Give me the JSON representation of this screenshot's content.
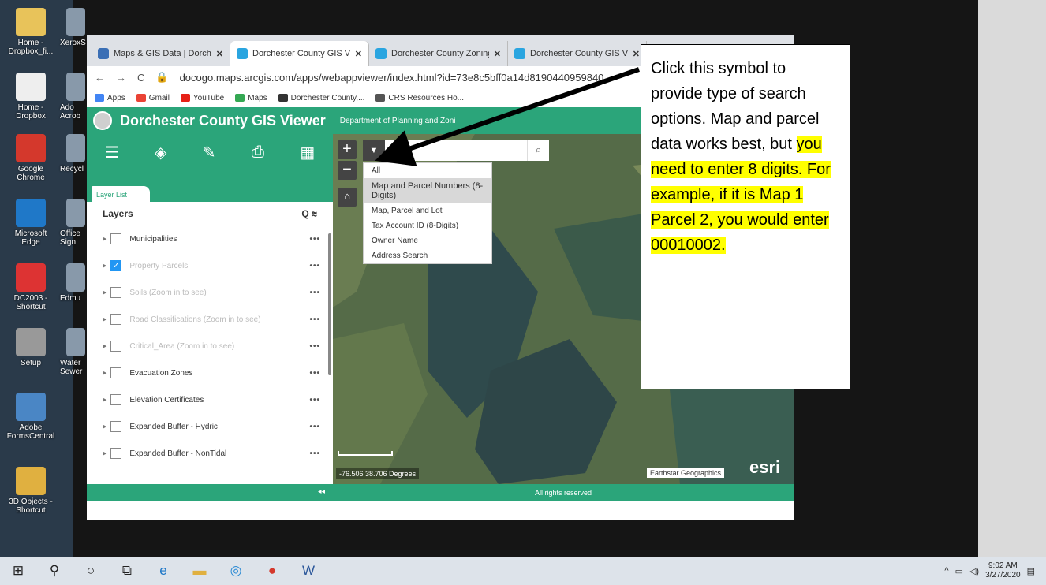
{
  "desktop": {
    "icons": [
      {
        "label": "Home - Dropbox_fi...",
        "color": "#e8c35a"
      },
      {
        "label": "Home - Dropbox",
        "color": "#eeeeee"
      },
      {
        "label": "Google Chrome",
        "color": "#d4382c"
      },
      {
        "label": "Microsoft Edge",
        "color": "#1f78c8"
      },
      {
        "label": "DC2003 - Shortcut",
        "color": "#d33"
      },
      {
        "label": "Setup",
        "color": "#999"
      },
      {
        "label": "Adobe FormsCentral",
        "color": "#4a86c5"
      },
      {
        "label": "3D Objects - Shortcut",
        "color": "#e0b040"
      }
    ],
    "icons2": [
      {
        "label": "XeroxS"
      },
      {
        "label": "Ado Acrob"
      },
      {
        "label": "Recycl"
      },
      {
        "label": "Office Sign"
      },
      {
        "label": "Edmu"
      },
      {
        "label": "Water Sewer"
      }
    ]
  },
  "browser": {
    "tabs": [
      {
        "label": "Maps & GIS Data | Dorche",
        "active": false,
        "color": "#3b6fb5"
      },
      {
        "label": "Dorchester County GIS Vie",
        "active": true,
        "color": "#2aa5e0"
      },
      {
        "label": "Dorchester County Zoning",
        "active": false,
        "color": "#2aa5e0"
      },
      {
        "label": "Dorchester County GIS Vie",
        "active": false,
        "color": "#2aa5e0"
      }
    ],
    "url": "docogo.maps.arcgis.com/apps/webappviewer/index.html?id=73e8c5bff0a14d8190440959840",
    "bookmarks": [
      {
        "label": "Apps",
        "color": "#4285f4"
      },
      {
        "label": "Gmail",
        "color": "#ea4335"
      },
      {
        "label": "YouTube",
        "color": "#e62117"
      },
      {
        "label": "Maps",
        "color": "#34a853"
      },
      {
        "label": "Dorchester County,...",
        "color": "#333"
      },
      {
        "label": "CRS Resources Ho...",
        "color": "#555"
      }
    ]
  },
  "app": {
    "title": "Dorchester County GIS Viewer",
    "subtitle": "Department of Planning and Zoni"
  },
  "layer_panel": {
    "tab_label": "Layer List",
    "heading": "Layers",
    "layers": [
      {
        "name": "Municipalities",
        "checked": false,
        "dim": false
      },
      {
        "name": "Property Parcels",
        "checked": true,
        "dim": true
      },
      {
        "name": "Soils (Zoom in to see)",
        "checked": false,
        "dim": true
      },
      {
        "name": "Road Classifications (Zoom in to see)",
        "checked": false,
        "dim": true
      },
      {
        "name": "Critical_Area (Zoom in to see)",
        "checked": false,
        "dim": true
      },
      {
        "name": "Evacuation Zones",
        "checked": false,
        "dim": false
      },
      {
        "name": "Elevation Certificates",
        "checked": false,
        "dim": false
      },
      {
        "name": "Expanded Buffer - Hydric",
        "checked": false,
        "dim": false
      },
      {
        "name": "Expanded Buffer - NonTidal",
        "checked": false,
        "dim": false
      }
    ]
  },
  "map": {
    "search_placeholder": "",
    "dropdown_options": [
      {
        "label": "All",
        "selected": false
      },
      {
        "label": "Map and Parcel Numbers (8-Digits)",
        "selected": true
      },
      {
        "label": "Map, Parcel and Lot",
        "selected": false
      },
      {
        "label": "Tax Account ID (8-Digits)",
        "selected": false
      },
      {
        "label": "Owner Name",
        "selected": false
      },
      {
        "label": "Address Search",
        "selected": false
      }
    ],
    "coordinates": "-76.506 38.706 Degrees",
    "attribution": "Earthstar Geographics",
    "logo_text": "esri",
    "footer": "All rights reserved"
  },
  "callout": {
    "plain": "Click this symbol to provide type of search options. Map and parcel data works best, but ",
    "highlighted": "you need to enter 8 digits. For example, if it is Map 1 Parcel 2, you would enter 00010002."
  },
  "taskbar": {
    "time": "9:02 AM",
    "date": "3/27/2020"
  }
}
